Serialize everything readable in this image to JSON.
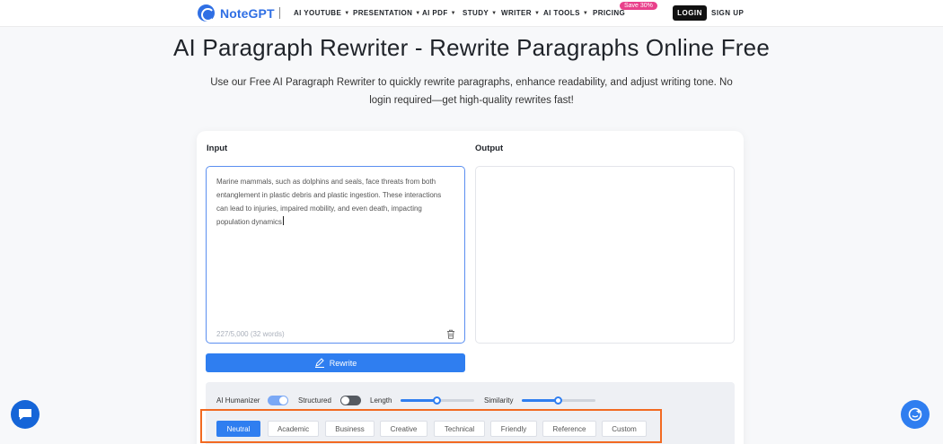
{
  "brand": {
    "name": "NoteGPT",
    "accent": "#2f6fe4"
  },
  "nav": {
    "items": [
      {
        "label": "AI YOUTUBE",
        "has_dropdown": true
      },
      {
        "label": "PRESENTATION",
        "has_dropdown": true
      },
      {
        "label": "AI PDF",
        "has_dropdown": true
      },
      {
        "label": "STUDY",
        "has_dropdown": true
      },
      {
        "label": "WRITER",
        "has_dropdown": true
      },
      {
        "label": "AI TOOLS",
        "has_dropdown": true
      },
      {
        "label": "PRICING",
        "has_dropdown": false
      }
    ],
    "pricing_badge": "Save 30%",
    "login_label": "LOGIN",
    "signup_label": "SIGN UP"
  },
  "hero": {
    "title": "AI Paragraph Rewriter - Rewrite Paragraphs Online Free",
    "subtitle": "Use our Free AI Paragraph Rewriter to quickly rewrite paragraphs, enhance readability, and adjust writing tone. No login required—get high-quality rewrites fast!"
  },
  "editor": {
    "input_label": "Input",
    "output_label": "Output",
    "input_text": "Marine mammals, such as dolphins and seals, face threats from both entanglement in plastic debris and plastic ingestion. These interactions can lead to injuries, impaired mobility, and even death, impacting population dynamics",
    "char_count": "227/5,000 (32 words)",
    "output_text": "",
    "rewrite_label": "Rewrite"
  },
  "settings": {
    "humanizer": {
      "label": "AI Humanizer",
      "on": true
    },
    "structured": {
      "label": "Structured",
      "on": false
    },
    "length": {
      "label": "Length",
      "value": 0.5
    },
    "similarity": {
      "label": "Similarity",
      "value": 0.5
    }
  },
  "tones": {
    "selected": "Neutral",
    "options": [
      "Neutral",
      "Academic",
      "Business",
      "Creative",
      "Technical",
      "Friendly",
      "Reference",
      "Custom"
    ]
  },
  "colors": {
    "primary": "#2f7ef0",
    "highlight_frame": "#f26a21",
    "badge": "#e9408b"
  }
}
